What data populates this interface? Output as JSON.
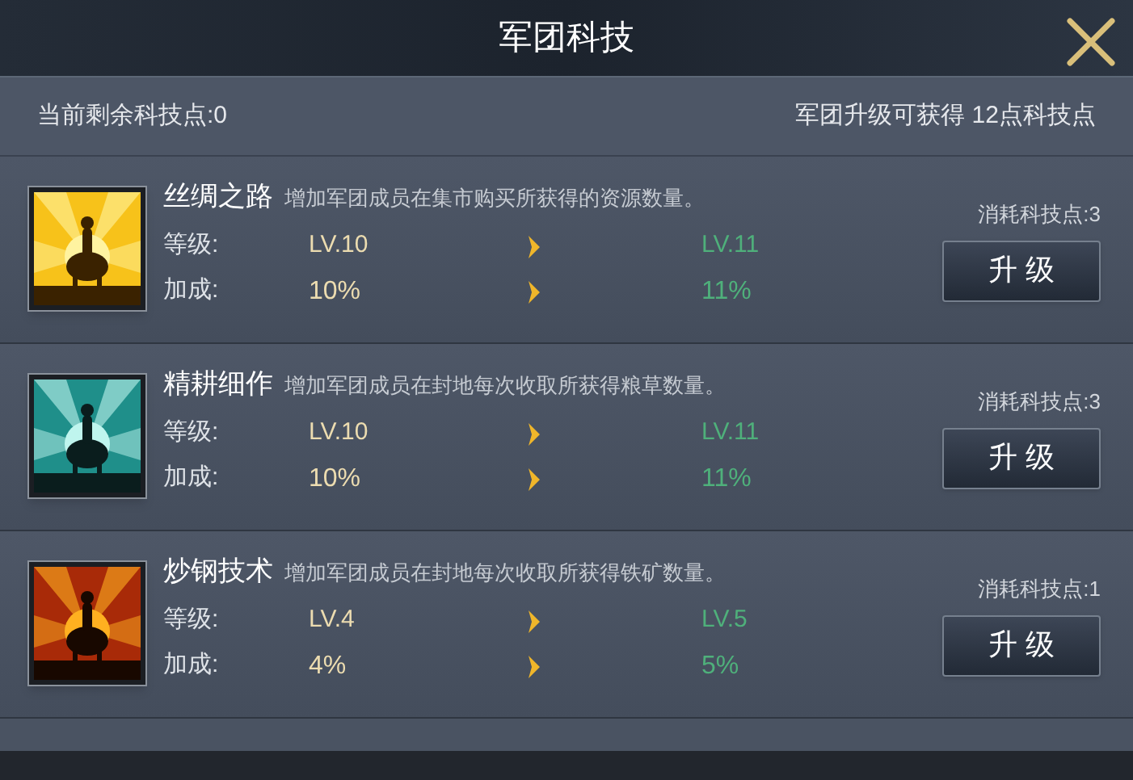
{
  "window": {
    "title": "军团科技"
  },
  "summary": {
    "remaining": "当前剩余科技点:0",
    "upgrade_reward": "军团升级可获得 12点科技点"
  },
  "techs": [
    {
      "name": "丝绸之路",
      "description": "增加军团成员在集市购买所获得的资源数量。",
      "level_label": "等级:",
      "level_current": "LV.10",
      "level_next": "LV.11",
      "bonus_label": "加成:",
      "bonus_current": "10%",
      "bonus_next": "11%",
      "cost": "消耗科技点:3",
      "button": "升 级"
    },
    {
      "name": "精耕细作",
      "description": "增加军团成员在封地每次收取所获得粮草数量。",
      "level_label": "等级:",
      "level_current": "LV.10",
      "level_next": "LV.11",
      "bonus_label": "加成:",
      "bonus_current": "10%",
      "bonus_next": "11%",
      "cost": "消耗科技点:3",
      "button": "升 级"
    },
    {
      "name": "炒钢技术",
      "description": "增加军团成员在封地每次收取所获得铁矿数量。",
      "level_label": "等级:",
      "level_current": "LV.4",
      "level_next": "LV.5",
      "bonus_label": "加成:",
      "bonus_current": "4%",
      "bonus_next": "5%",
      "cost": "消耗科技点:1",
      "button": "升 级"
    }
  ]
}
